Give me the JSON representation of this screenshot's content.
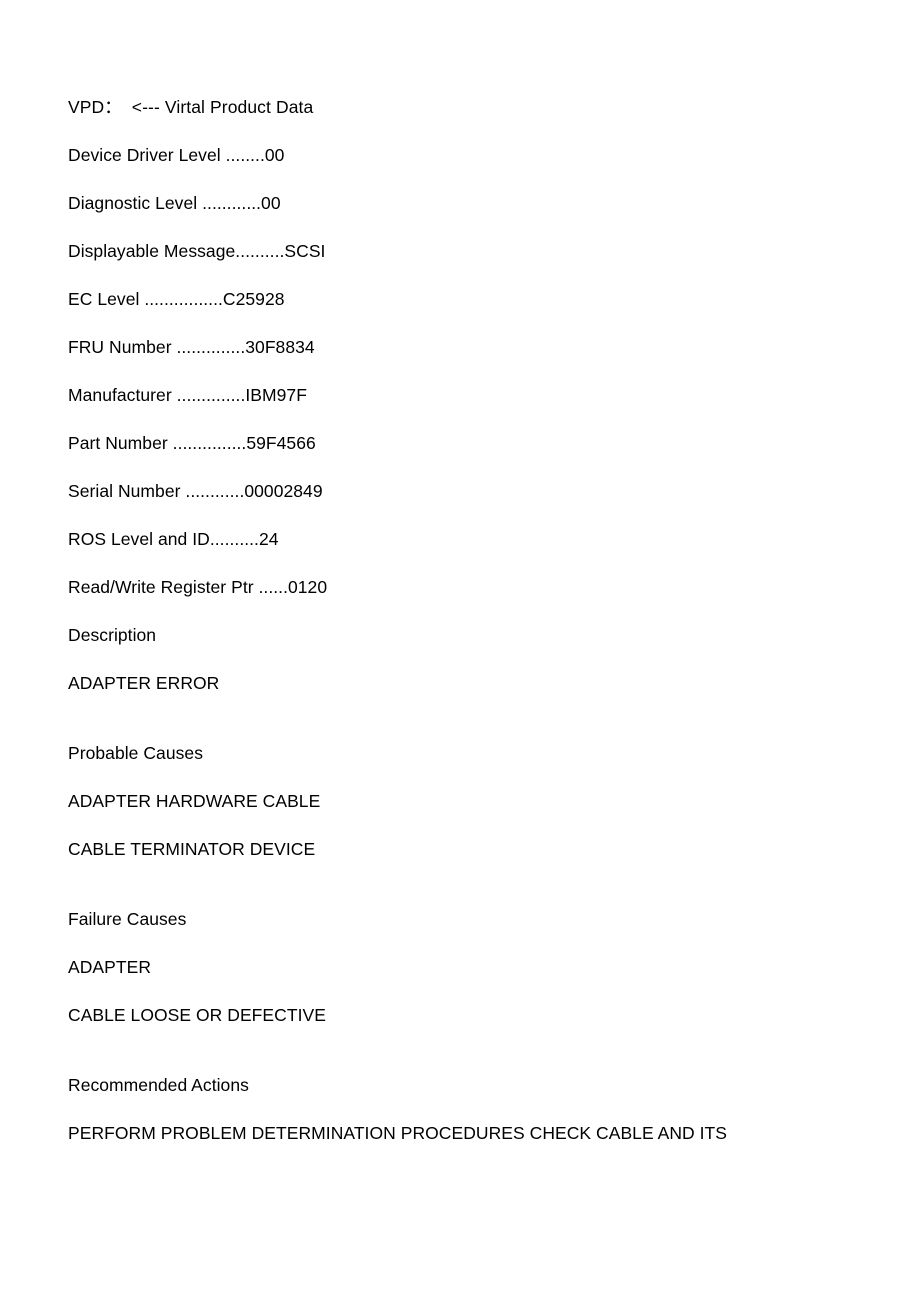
{
  "document": {
    "title_line": "VPD：  <--- Virtal Product Data",
    "vpd_fields": [
      {
        "text": "Device Driver Level ........00"
      },
      {
        "text": "Diagnostic Level ............00"
      },
      {
        "text": "Displayable Message..........SCSI"
      },
      {
        "text": "EC Level ................C25928"
      },
      {
        "text": "FRU Number ..............30F8834"
      },
      {
        "text": "Manufacturer ..............IBM97F"
      },
      {
        "text": "Part Number ...............59F4566"
      },
      {
        "text": "Serial Number ............00002849"
      },
      {
        "text": "ROS Level and ID..........24"
      },
      {
        "text": "Read/Write Register Ptr ......0120"
      }
    ],
    "sections": [
      {
        "heading": "Description",
        "items": [
          "ADAPTER ERROR"
        ]
      },
      {
        "heading": "Probable Causes",
        "items": [
          "ADAPTER HARDWARE CABLE",
          "CABLE TERMINATOR DEVICE"
        ]
      },
      {
        "heading": "Failure Causes",
        "items": [
          "ADAPTER",
          "CABLE LOOSE OR DEFECTIVE"
        ]
      },
      {
        "heading": "Recommended Actions",
        "items": [
          "PERFORM PROBLEM DETERMINATION PROCEDURES CHECK CABLE AND ITS"
        ]
      }
    ]
  }
}
